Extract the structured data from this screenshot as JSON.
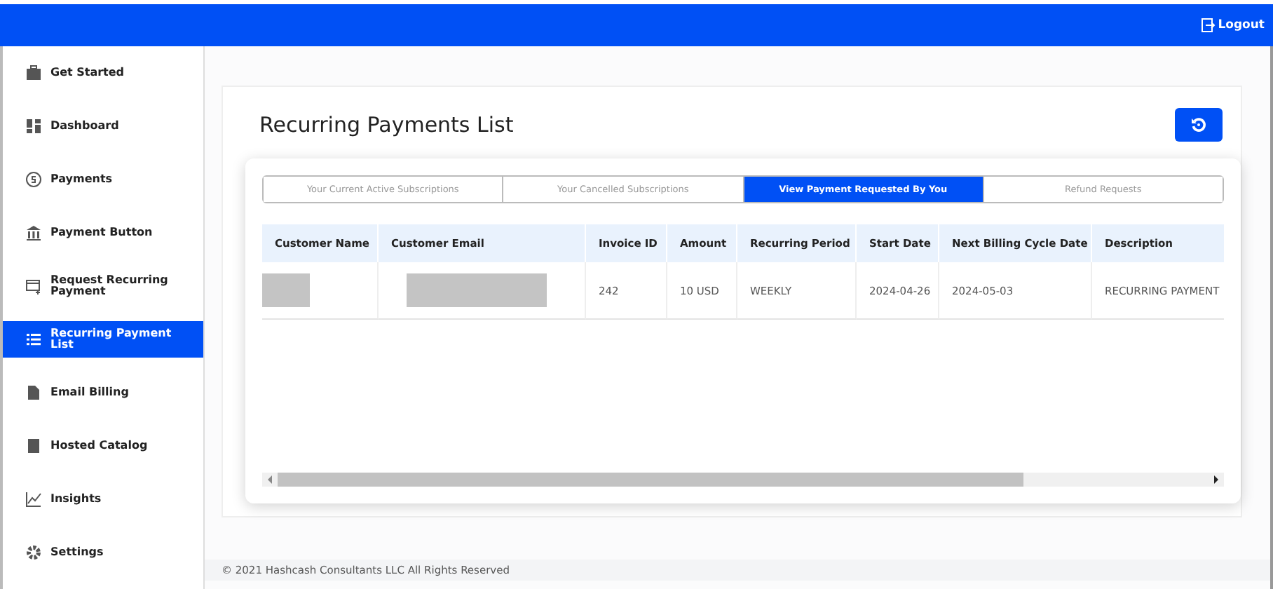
{
  "topbar": {
    "logout": "Logout"
  },
  "sidebar": {
    "items": [
      {
        "label": "Get Started",
        "selected": false
      },
      {
        "label": "Dashboard",
        "selected": false
      },
      {
        "label": "Payments",
        "selected": false
      },
      {
        "label": "Payment Button",
        "selected": false
      },
      {
        "label": "Request Recurring Payment",
        "selected": false
      },
      {
        "label": "Recurring Payment List",
        "selected": true
      },
      {
        "label": "Email Billing",
        "selected": false
      },
      {
        "label": "Hosted Catalog",
        "selected": false
      },
      {
        "label": "Insights",
        "selected": false
      },
      {
        "label": "Settings",
        "selected": false
      }
    ]
  },
  "page": {
    "title": "Recurring Payments List"
  },
  "tabs": [
    {
      "label": "Your Current Active Subscriptions",
      "selected": false
    },
    {
      "label": "Your Cancelled Subscriptions",
      "selected": false
    },
    {
      "label": "View Payment Requested By You",
      "selected": true
    },
    {
      "label": "Refund Requests",
      "selected": false
    }
  ],
  "table": {
    "columns": [
      "Customer Name",
      "Customer Email",
      "Invoice ID",
      "Amount",
      "Recurring Period",
      "Start Date",
      "Next Billing Cycle Date",
      "Description"
    ],
    "rows": [
      {
        "cells": [
          {
            "kind": "redacted"
          },
          {
            "kind": "redacted"
          },
          {
            "kind": "text",
            "text": "242"
          },
          {
            "kind": "text",
            "text": "10 USD"
          },
          {
            "kind": "text",
            "text": "WEEKLY"
          },
          {
            "kind": "text",
            "text": "2024-04-26"
          },
          {
            "kind": "text",
            "text": "2024-05-03"
          },
          {
            "kind": "text",
            "text": "RECURRING PAYMENT"
          }
        ]
      }
    ]
  },
  "footer": "© 2021 Hashcash Consultants LLC All Rights Reserved"
}
